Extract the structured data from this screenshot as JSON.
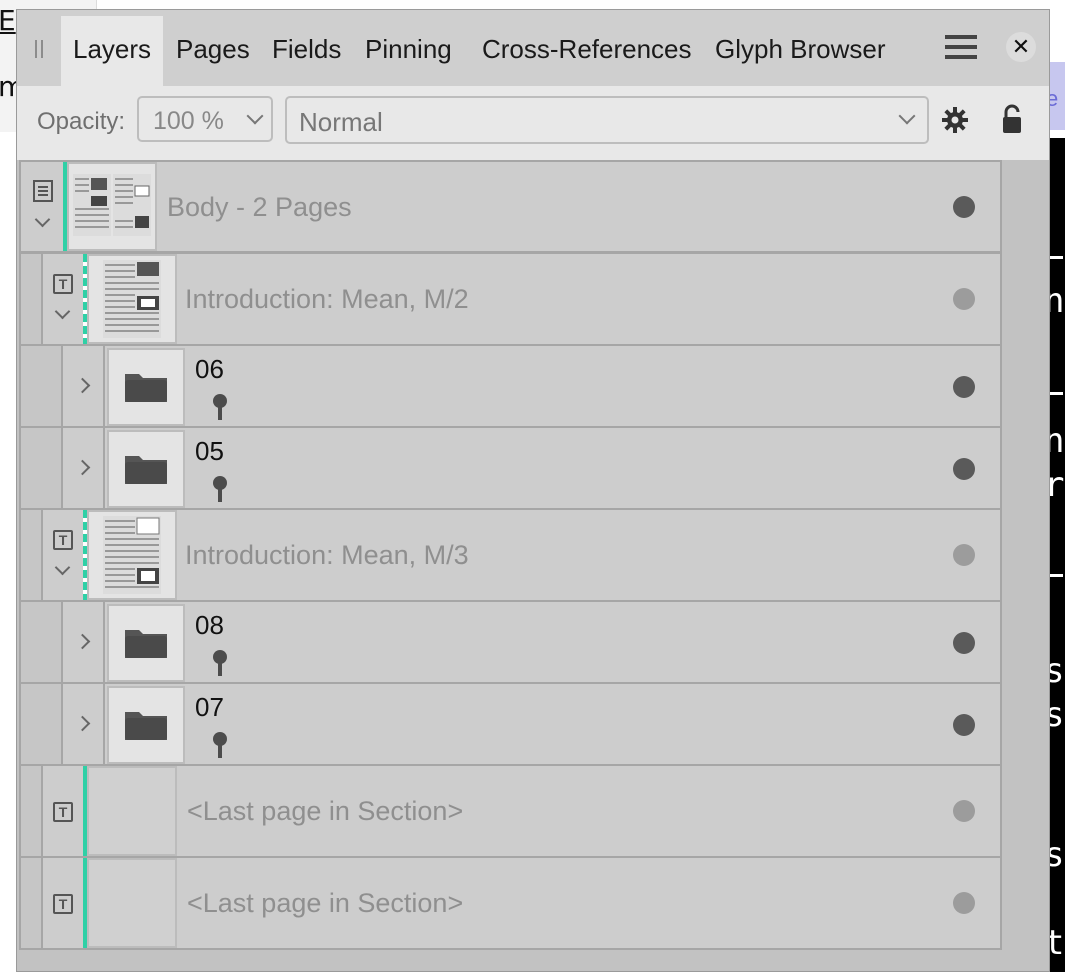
{
  "background": {
    "left_fragments": [
      "E",
      "m"
    ],
    "right_fragment": "e",
    "right_dark_letters": [
      "n",
      "n",
      "r",
      "s",
      "s",
      "s",
      "t"
    ]
  },
  "tabs": [
    "Layers",
    "Pages",
    "Fields",
    "Pinning",
    "Cross-References",
    "Glyph Browser"
  ],
  "active_tab": "Layers",
  "toolbar": {
    "opacity_label": "Opacity:",
    "opacity_value": "100 %",
    "blend_mode": "Normal"
  },
  "colors": {
    "accent": "#2fd0a6",
    "panel_bg": "#c2c2c2",
    "row_bg": "#cdcdcd"
  },
  "layers": [
    {
      "name": "Body - 2 Pages",
      "kind": "spread",
      "icon": "page-list-icon",
      "expanded": true,
      "visible_dot": "dark"
    },
    {
      "name": "Introduction: Mean, M/2",
      "kind": "master",
      "icon": "text-frame-icon",
      "expanded": true,
      "visible_dot": "light"
    },
    {
      "name": "06",
      "kind": "group",
      "icon": "folder-icon",
      "pinned": true,
      "visible_dot": "dark"
    },
    {
      "name": "05",
      "kind": "group",
      "icon": "folder-icon",
      "pinned": true,
      "visible_dot": "dark"
    },
    {
      "name": "Introduction: Mean, M/3",
      "kind": "master",
      "icon": "text-frame-icon",
      "expanded": true,
      "visible_dot": "light"
    },
    {
      "name": "08",
      "kind": "group",
      "icon": "folder-icon",
      "pinned": true,
      "visible_dot": "dark"
    },
    {
      "name": "07",
      "kind": "group",
      "icon": "folder-icon",
      "pinned": true,
      "visible_dot": "dark"
    },
    {
      "name": "<Last page in Section>",
      "kind": "page",
      "icon": "text-frame-icon",
      "visible_dot": "light"
    },
    {
      "name": "<Last page in Section>",
      "kind": "page",
      "icon": "text-frame-icon",
      "visible_dot": "light"
    }
  ]
}
